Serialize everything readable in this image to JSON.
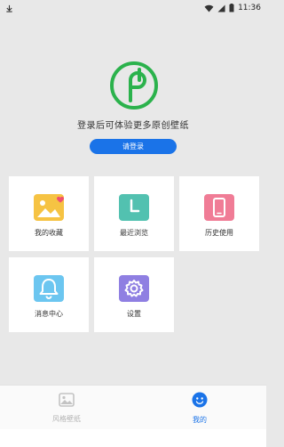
{
  "status_bar": {
    "time": "11:36"
  },
  "login": {
    "hint": "登录后可体验更多原创壁纸",
    "button": "请登录"
  },
  "menu": [
    {
      "label": "我的收藏",
      "icon": "favorites-image-icon",
      "color": "#f6c343"
    },
    {
      "label": "最近浏览",
      "icon": "recent-clock-icon",
      "color": "#52c1b0"
    },
    {
      "label": "历史使用",
      "icon": "history-phone-icon",
      "color": "#f07c96"
    },
    {
      "label": "消息中心",
      "icon": "bell-icon",
      "color": "#6cc6f0"
    },
    {
      "label": "设置",
      "icon": "gear-icon",
      "color": "#8f7fe2"
    }
  ],
  "tabs": [
    {
      "label": "风格壁纸",
      "icon": "wallpaper-icon",
      "active": false
    },
    {
      "label": "我的",
      "icon": "profile-icon",
      "active": true
    }
  ],
  "colors": {
    "accent": "#1a73e8",
    "logo": "#2bb24c",
    "background": "#e8e8e8"
  }
}
